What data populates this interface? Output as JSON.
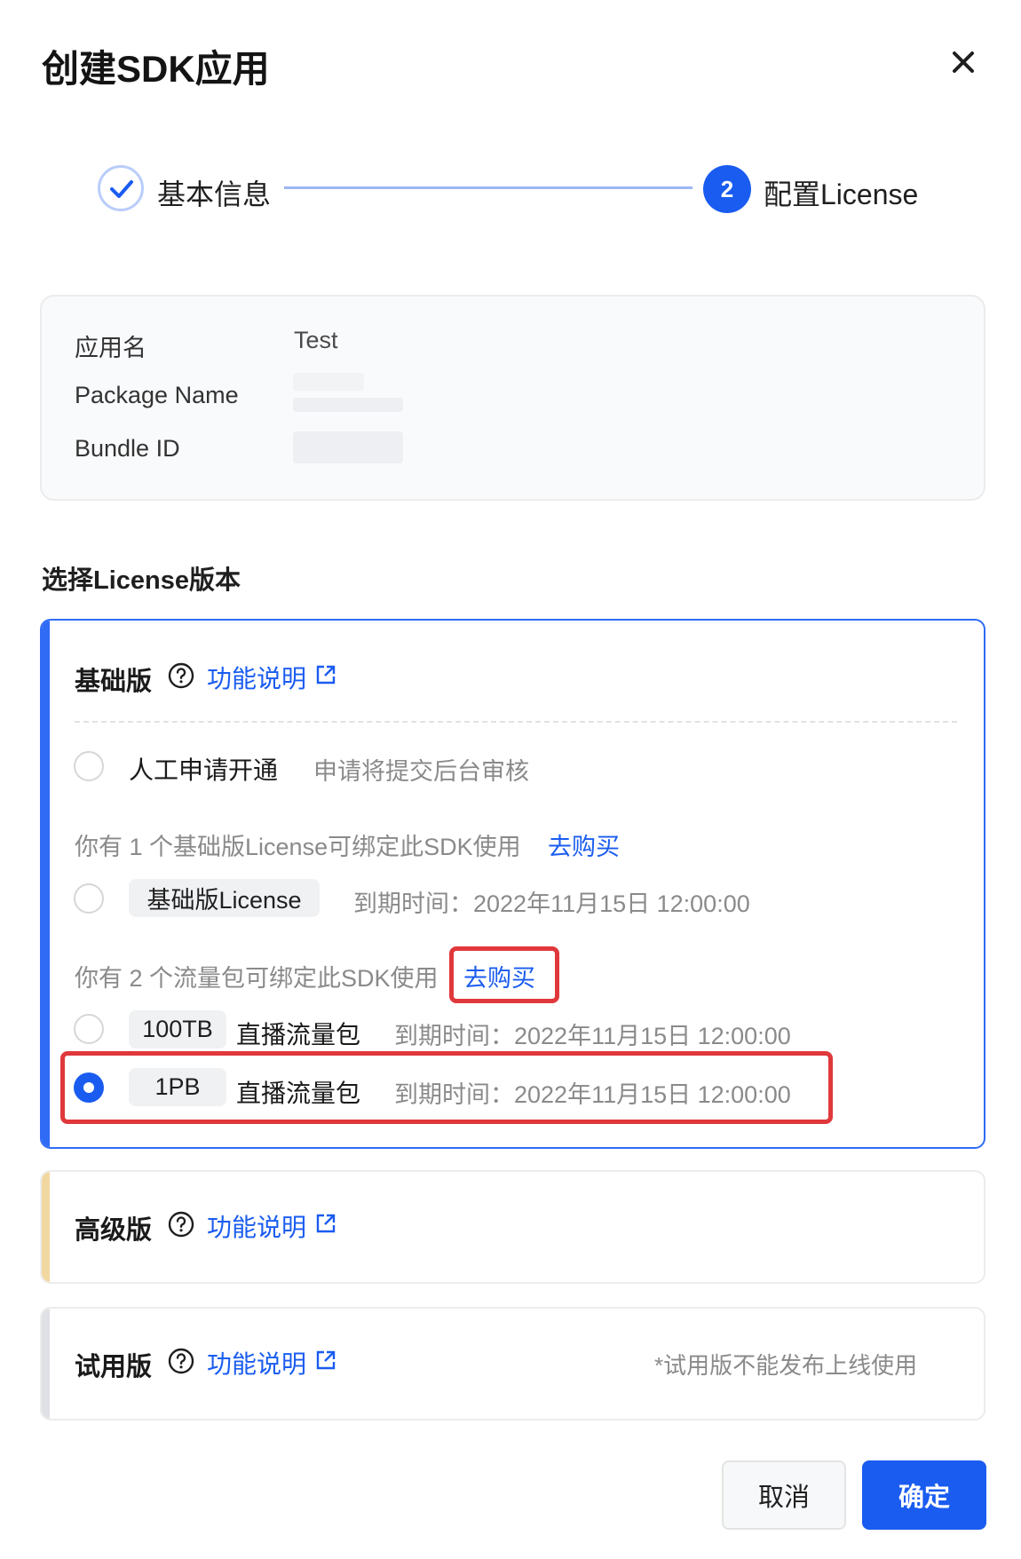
{
  "dialog": {
    "title": "创建SDK应用"
  },
  "steps": [
    {
      "label": "基本信息",
      "state": "done"
    },
    {
      "number": "2",
      "label": "配置License",
      "state": "active"
    }
  ],
  "app_info": {
    "name_label": "应用名",
    "name_value": "Test",
    "package_label": "Package Name",
    "bundle_label": "Bundle ID"
  },
  "section_title": "选择License版本",
  "tiers": {
    "basic": {
      "title": "基础版",
      "doc_link": "功能说明",
      "manual": {
        "label": "人工申请开通",
        "hint": "申请将提交后台审核",
        "checked": false
      },
      "license_notice": "你有 1 个基础版License可绑定此SDK使用",
      "license_buy": "去购买",
      "license_option": {
        "tag": "基础版License",
        "expiry": "到期时间：2022年11月15日  12:00:00",
        "checked": false
      },
      "traffic_notice": "你有 2 个流量包可绑定此SDK使用",
      "traffic_buy": "去购买",
      "traffic_options": [
        {
          "tag": "100TB",
          "label": "直播流量包",
          "expiry": "到期时间：2022年11月15日 12:00:00",
          "checked": false
        },
        {
          "tag": "1PB",
          "label": "直播流量包",
          "expiry": "到期时间：2022年11月15日 12:00:00",
          "checked": true
        }
      ]
    },
    "advanced": {
      "title": "高级版",
      "doc_link": "功能说明"
    },
    "trial": {
      "title": "试用版",
      "doc_link": "功能说明",
      "note": "*试用版不能发布上线使用"
    }
  },
  "footer": {
    "cancel": "取消",
    "confirm": "确定"
  },
  "colors": {
    "primary": "#1a5cf0",
    "highlight": "#e0383b",
    "advanced_accent": "#f1d7a0"
  }
}
